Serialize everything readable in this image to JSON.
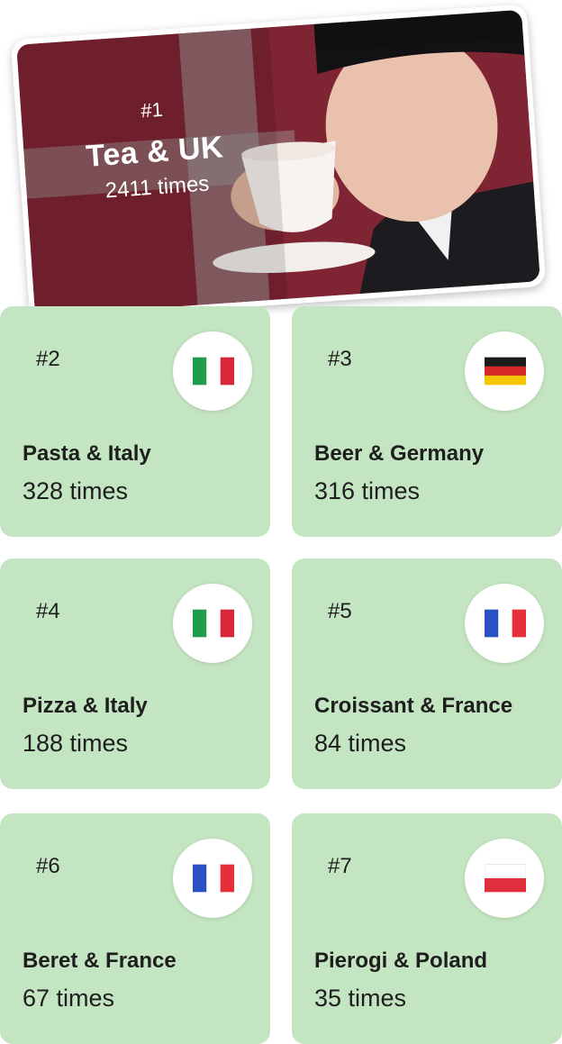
{
  "hero": {
    "rank": "#1",
    "title": "Tea & UK",
    "count": "2411 times",
    "image": "man-drinking-tea-photo"
  },
  "cards": [
    {
      "rank": "#2",
      "title": "Pasta & Italy",
      "count": "328 times",
      "flag": "italy-flag-icon"
    },
    {
      "rank": "#3",
      "title": "Beer & Germany",
      "count": "316 times",
      "flag": "germany-flag-icon"
    },
    {
      "rank": "#4",
      "title": "Pizza & Italy",
      "count": "188 times",
      "flag": "italy-flag-icon"
    },
    {
      "rank": "#5",
      "title": "Croissant & France",
      "count": "84 times",
      "flag": "france-flag-icon"
    },
    {
      "rank": "#6",
      "title": "Beret & France",
      "count": "67 times",
      "flag": "france-flag-icon"
    },
    {
      "rank": "#7",
      "title": "Pierogi & Poland",
      "count": "35 times",
      "flag": "poland-flag-icon"
    }
  ],
  "colors": {
    "card_bg": "#c4e5c1",
    "text": "#1e1e1e"
  }
}
